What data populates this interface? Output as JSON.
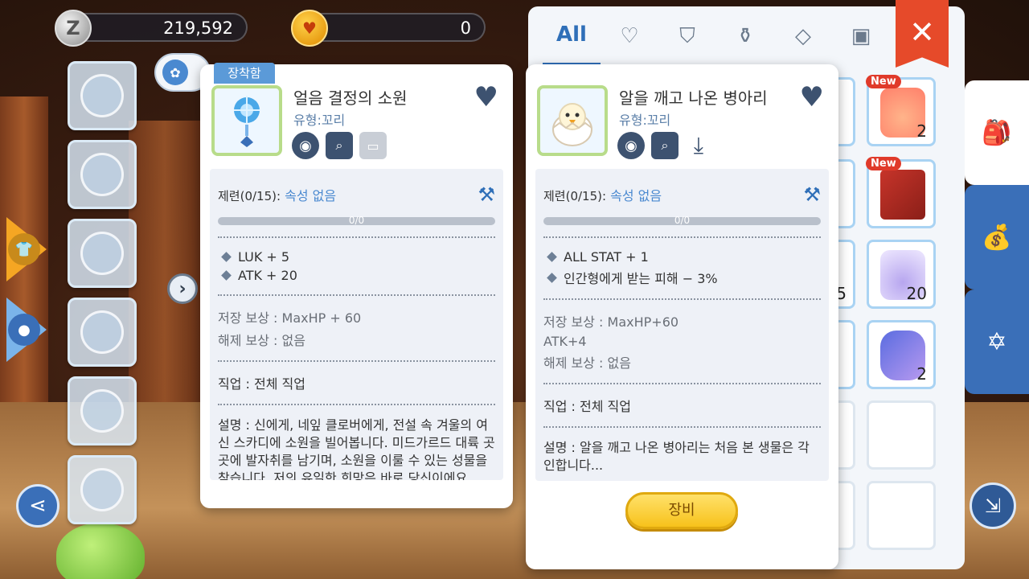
{
  "currency": {
    "zeny": "219,592",
    "cat_coin": "0"
  },
  "inventory": {
    "tabs": [
      "All",
      "heart-icon",
      "shirt-icon",
      "potion-icon",
      "diamond-icon",
      "card-icon"
    ],
    "all_label": "All",
    "items": [
      {
        "count": "2",
        "badge": "New"
      },
      {
        "count": "",
        "badge": "New"
      },
      {
        "count": "5"
      },
      {
        "count": "20"
      },
      {
        "count": "2"
      }
    ]
  },
  "left_card": {
    "equipped_tag": "장착함",
    "title": "얼음 결정의 소원",
    "type": "유형:꼬리",
    "refine_label": "제련(0/15):",
    "refine_attr": "속성 없음",
    "progress": "0/0",
    "stats": [
      "LUK + 5",
      "ATK + 20"
    ],
    "store_reward": "저장 보상 :  MaxHP + 60",
    "release_reward": "해제 보상 :  없음",
    "job": "직업 :  전체 직업",
    "description": "설명 :  신에게, 네잎 클로버에게, 전설 속 겨울의 여신 스카디에 소원을 빌어봅니다. 미드가르드 대륙 곳곳에 발자취를 남기며, 소원을 이룰 수 있는 성물을 찾습니다. 저의 유일한 희망은 바로 당신이에요..."
  },
  "right_card": {
    "title": "알을 깨고 나온 병아리",
    "type": "유형:꼬리",
    "refine_label": "제련(0/15):",
    "refine_attr": "속성 없음",
    "progress": "0/0",
    "stats": [
      "ALL STAT + 1",
      "인간형에게 받는 피해 − 3%"
    ],
    "store_reward_1": "저장 보상 :  MaxHP+60",
    "store_reward_2": "ATK+4",
    "release_reward": "해제 보상 :  없음",
    "job": "직업 :  전체 직업",
    "description": "설명 :  알을 깨고 나온 병아리는 처음 본 생물은 각인합니다...",
    "equip_button": "장비"
  },
  "colors": {
    "accent_blue": "#3a6fb8",
    "close_red": "#e64a2a",
    "equip_yellow": "#f7c21b",
    "frame_green": "#b8dc8a"
  }
}
